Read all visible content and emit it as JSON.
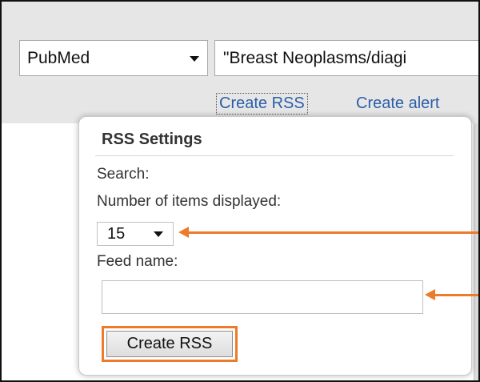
{
  "search_bar": {
    "database_value": "PubMed",
    "query_value": "\"Breast Neoplasms/diagi"
  },
  "links": {
    "create_rss": "Create RSS",
    "create_alert": "Create alert"
  },
  "rss_popup": {
    "title": "RSS Settings",
    "search_label": "Search:",
    "items_label": "Number of items displayed:",
    "items_value": "15",
    "feed_label": "Feed name:",
    "feed_value": "",
    "create_button": "Create RSS"
  },
  "colors": {
    "highlight": "#ee7a2b",
    "link": "#2b5ea8"
  },
  "icons": {
    "dropdown": "chevron-down-icon",
    "annotation": "arrow-left-icon"
  }
}
